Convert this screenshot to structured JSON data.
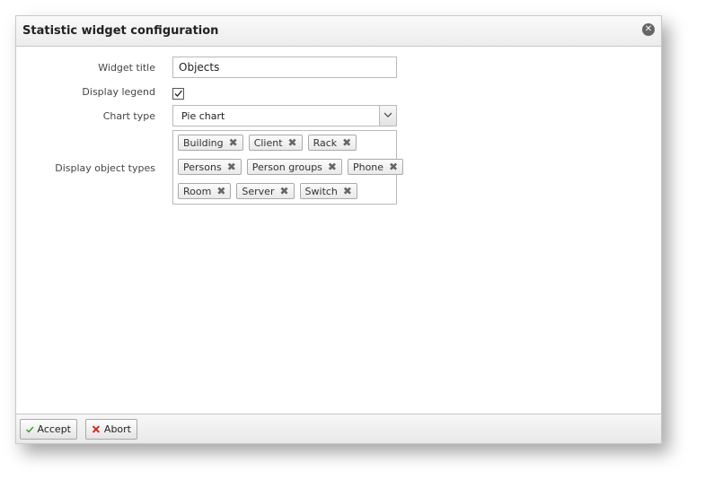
{
  "dialog": {
    "title": "Statistic widget configuration",
    "close_icon": "close-icon"
  },
  "form": {
    "widget_title_label": "Widget title",
    "widget_title_value": "Objects",
    "display_legend_label": "Display legend",
    "display_legend_checked": true,
    "chart_type_label": "Chart type",
    "chart_type_value": "Pie chart",
    "display_object_types_label": "Display object types",
    "object_types": [
      [
        "Building",
        "Client",
        "Rack"
      ],
      [
        "Persons",
        "Person groups",
        "Phone"
      ],
      [
        "Room",
        "Server",
        "Switch"
      ]
    ],
    "tag_remove_glyph": "✖"
  },
  "footer": {
    "accept_label": "Accept",
    "abort_label": "Abort",
    "accept_icon": "checkmark-icon",
    "abort_icon": "cross-icon",
    "accept_color": "#3a9a2a",
    "abort_color": "#d02a1e"
  }
}
